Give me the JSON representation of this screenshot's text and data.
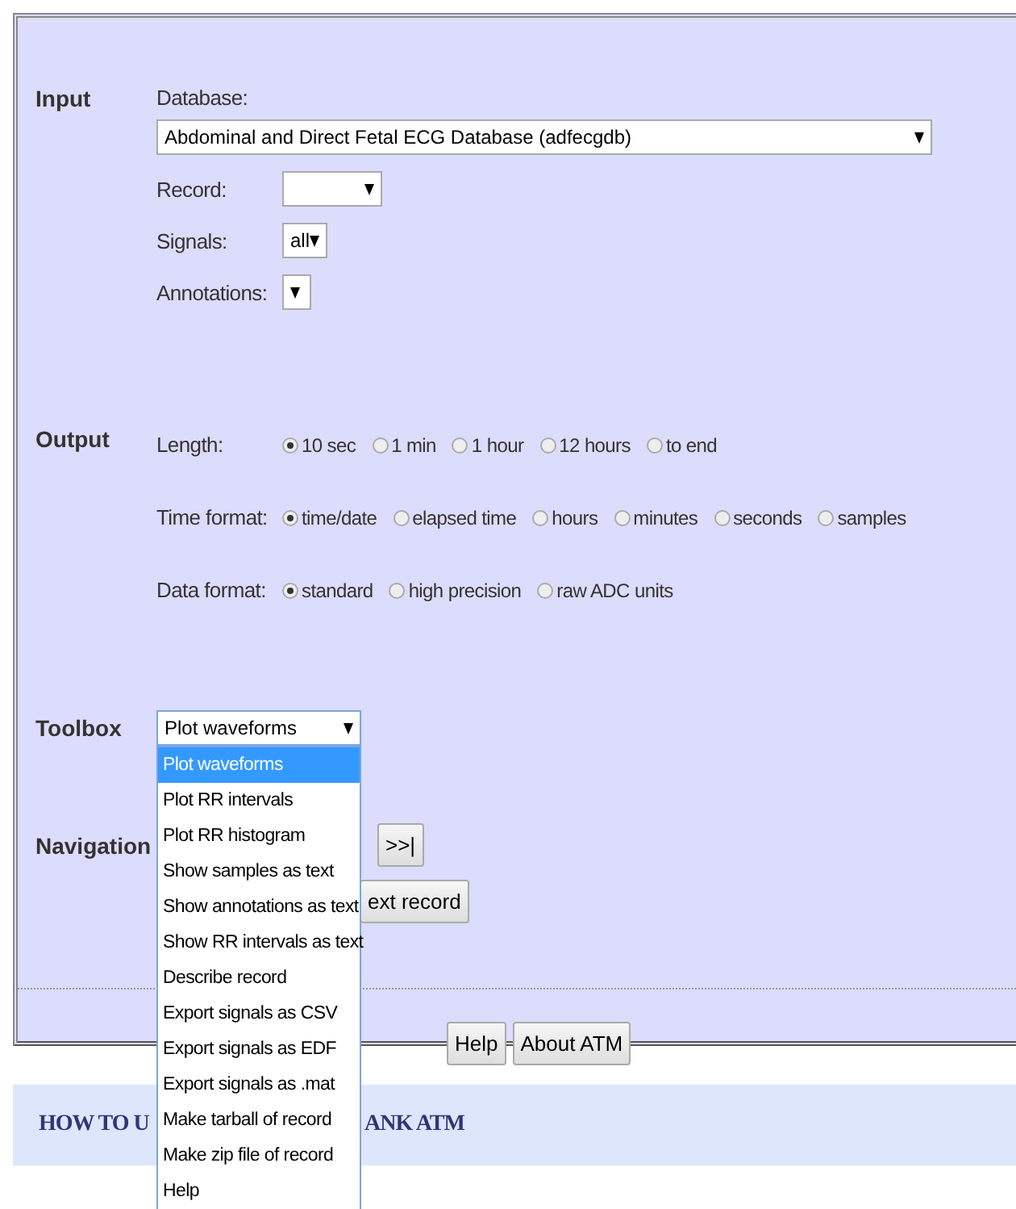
{
  "input": {
    "title": "Input",
    "database": {
      "label": "Database:",
      "value": "Abdominal and Direct Fetal ECG Database (adfecgdb)"
    },
    "record": {
      "label": "Record:"
    },
    "signals": {
      "label": "Signals:",
      "value": "all"
    },
    "annotations": {
      "label": "Annotations:"
    }
  },
  "output": {
    "title": "Output",
    "groups": [
      {
        "label": "Length:",
        "options": [
          {
            "label": "10 sec",
            "selected": true
          },
          {
            "label": "1 min",
            "selected": false
          },
          {
            "label": "1 hour",
            "selected": false
          },
          {
            "label": "12 hours",
            "selected": false
          },
          {
            "label": "to end",
            "selected": false
          }
        ]
      },
      {
        "label": "Time format:",
        "options": [
          {
            "label": "time/date",
            "selected": true
          },
          {
            "label": "elapsed time",
            "selected": false
          },
          {
            "label": "hours",
            "selected": false
          },
          {
            "label": "minutes",
            "selected": false
          },
          {
            "label": "seconds",
            "selected": false
          },
          {
            "label": "samples",
            "selected": false
          }
        ]
      },
      {
        "label": "Data format:",
        "options": [
          {
            "label": "standard",
            "selected": true
          },
          {
            "label": "high precision",
            "selected": false
          },
          {
            "label": "raw ADC units",
            "selected": false
          }
        ]
      }
    ]
  },
  "toolbox": {
    "title": "Toolbox",
    "value": "Plot waveforms",
    "expanded": true,
    "options": [
      {
        "label": "Plot waveforms",
        "selected": true
      },
      {
        "label": "Plot RR intervals",
        "selected": false
      },
      {
        "label": "Plot RR histogram",
        "selected": false
      },
      {
        "label": "Show samples as text",
        "selected": false
      },
      {
        "label": "Show annotations as text",
        "selected": false
      },
      {
        "label": "Show RR intervals as text",
        "selected": false
      },
      {
        "label": "Describe record",
        "selected": false
      },
      {
        "label": "Export signals as CSV",
        "selected": false
      },
      {
        "label": "Export signals as EDF",
        "selected": false
      },
      {
        "label": "Export signals as .mat",
        "selected": false
      },
      {
        "label": "Make tarball of record",
        "selected": false
      },
      {
        "label": "Make zip file of record",
        "selected": false
      },
      {
        "label": "Help",
        "selected": false
      }
    ]
  },
  "navigation": {
    "title": "Navigation",
    "buttons": [
      [
        ">>|"
      ],
      [
        "ext record"
      ]
    ]
  },
  "footer_buttons": [
    "Help",
    "About ATM"
  ],
  "heading": [
    "HOW TO U",
    "ANK ATM"
  ]
}
